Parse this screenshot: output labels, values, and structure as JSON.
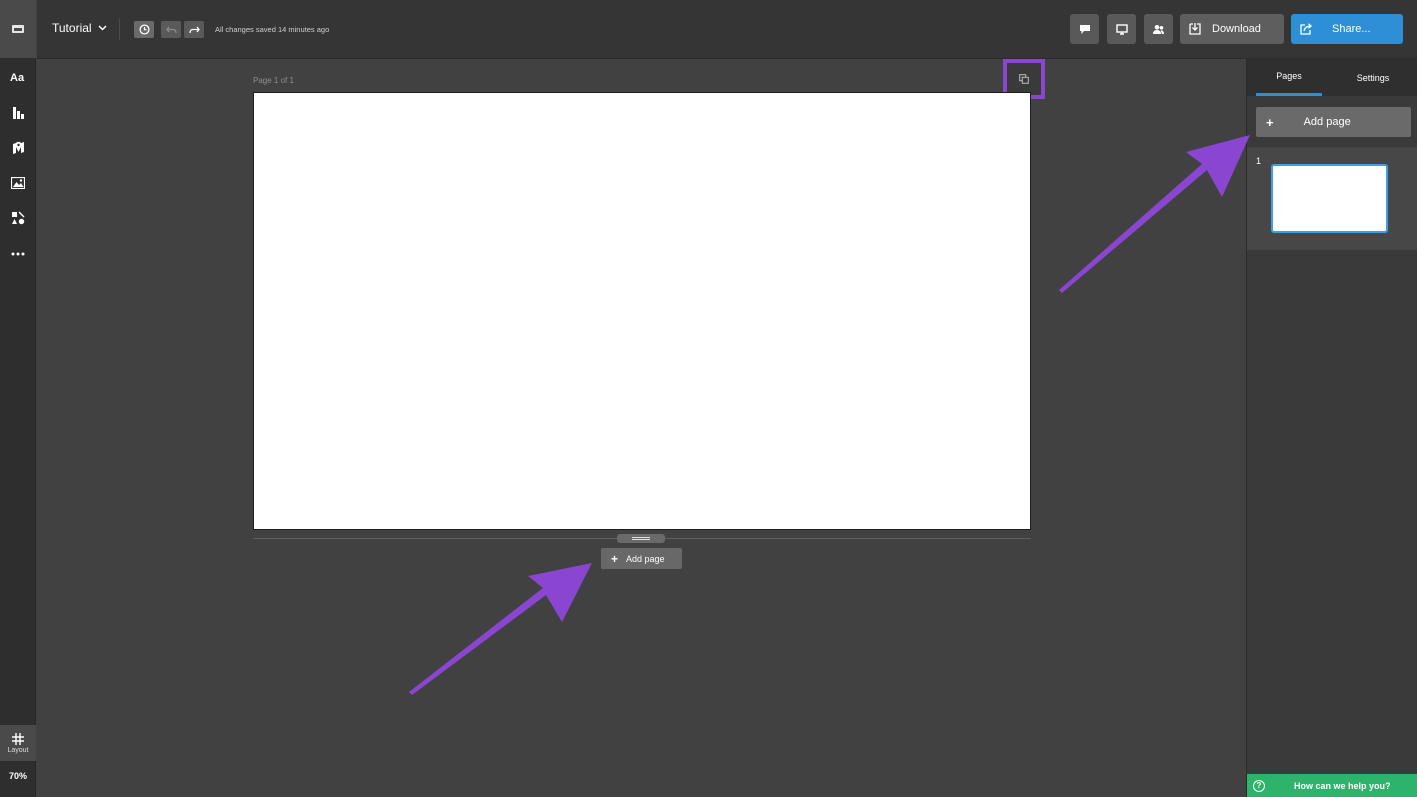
{
  "header": {
    "doc_title": "Tutorial",
    "save_status": "All changes saved 14 minutes ago",
    "download_label": "Download",
    "share_label": "Share..."
  },
  "left_toolbar": {
    "tools": [
      "text-tool",
      "chart-tool",
      "map-tool",
      "image-tool",
      "shapes-tool",
      "more-tool"
    ],
    "layout_label": "Layout",
    "zoom": "70%"
  },
  "canvas": {
    "page_label": "Page 1 of 1",
    "add_page_label": "Add page"
  },
  "right_panel": {
    "tabs": [
      {
        "label": "Pages",
        "active": true
      },
      {
        "label": "Settings",
        "active": false
      }
    ],
    "add_page_label": "Add page",
    "pages": [
      {
        "number": "1"
      }
    ]
  },
  "help": {
    "label": "How can we help you?",
    "color": "#2eb36b"
  },
  "colors": {
    "accent": "#2e8fd6",
    "annotation": "#8a46d1"
  }
}
